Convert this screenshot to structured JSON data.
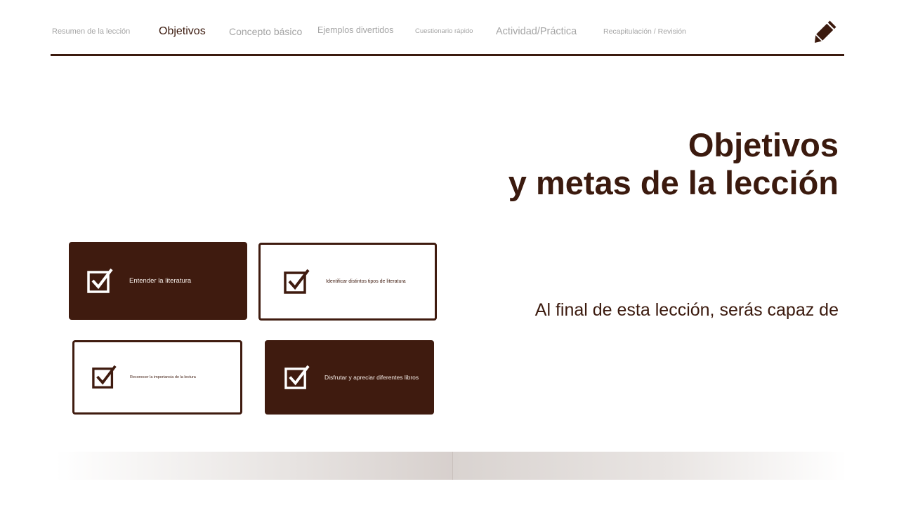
{
  "nav": {
    "items": [
      {
        "label": "Resumen de la lección"
      },
      {
        "label": "Objetivos"
      },
      {
        "label": "Concepto básico"
      },
      {
        "label": "Ejemplos divertidos"
      },
      {
        "label": "Cuestionario rápido"
      },
      {
        "label": "Actividad/Práctica"
      },
      {
        "label": "Recapitulación / Revisión"
      }
    ],
    "active_index": 1,
    "edit_icon": "pencil-icon"
  },
  "title": {
    "line1": "Objetivos",
    "line2": "y metas de la lección"
  },
  "subtitle": "Al final de esta lección, serás capaz de",
  "objectives": [
    {
      "label": "Entender la literatura",
      "style": "dark"
    },
    {
      "label": "Identificar distintos tipos de literatura",
      "style": "light"
    },
    {
      "label": "Reconocer la importancia de la lectura",
      "style": "light"
    },
    {
      "label": "Disfrutar y apreciar diferentes libros",
      "style": "dark"
    }
  ],
  "colors": {
    "primary": "#3f1b0f",
    "muted": "#a5a5a5",
    "background": "#ffffff"
  }
}
